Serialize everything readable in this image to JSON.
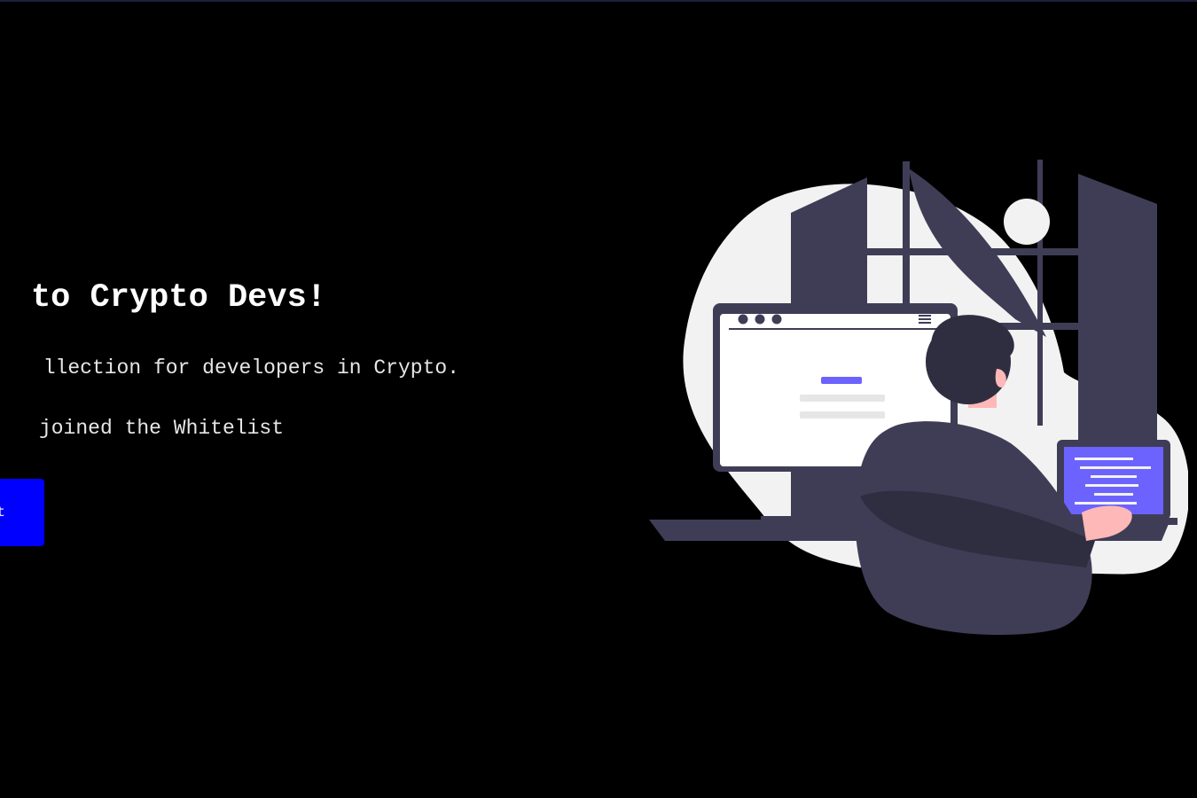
{
  "hero": {
    "title": "to Crypto Devs!",
    "description": "llection for developers in Crypto.",
    "whitelist_count_text": " joined the Whitelist",
    "button_label": "t"
  },
  "colors": {
    "background": "#000000",
    "button": "#0000ff",
    "illustration_dark": "#3f3d56",
    "illustration_light": "#f2f2f2",
    "illustration_accent": "#6c63ff",
    "skin": "#ffb8b8"
  },
  "illustration": {
    "icon": "developer-at-computer-illustration"
  }
}
